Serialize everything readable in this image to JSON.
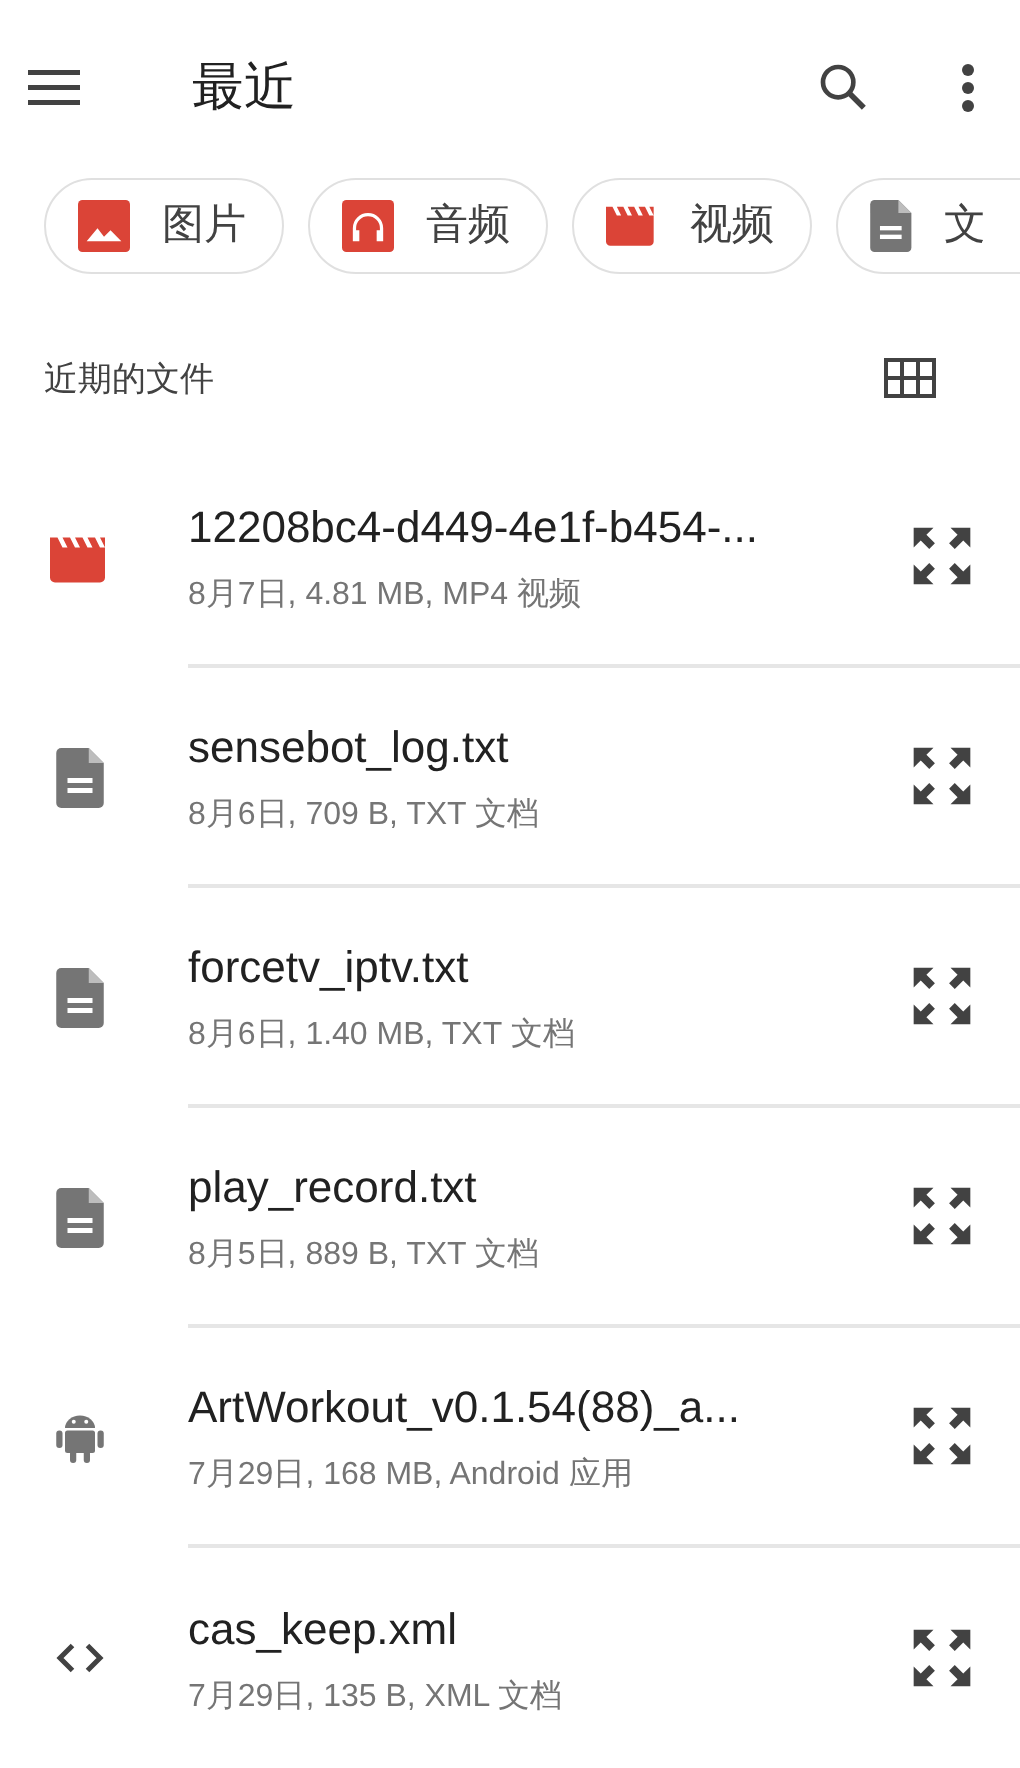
{
  "toolbar": {
    "title": "最近"
  },
  "categories": [
    {
      "kind": "image",
      "label": "图片"
    },
    {
      "kind": "audio",
      "label": "音频"
    },
    {
      "kind": "video",
      "label": "视频"
    },
    {
      "kind": "document",
      "label": "文"
    }
  ],
  "section": {
    "title": "近期的文件"
  },
  "files": [
    {
      "kind": "video",
      "name": "12208bc4-d449-4e1f-b454-...",
      "details": "8月7日, 4.81 MB, MP4 视频"
    },
    {
      "kind": "document",
      "name": "sensebot_log.txt",
      "details": "8月6日, 709 B, TXT 文档"
    },
    {
      "kind": "document",
      "name": "forcetv_iptv.txt",
      "details": "8月6日, 1.40 MB, TXT 文档"
    },
    {
      "kind": "document",
      "name": "play_record.txt",
      "details": "8月5日, 889 B, TXT 文档"
    },
    {
      "kind": "android",
      "name": "ArtWorkout_v0.1.54(88)_a...",
      "details": "7月29日, 168 MB, Android 应用"
    },
    {
      "kind": "code",
      "name": "cas_keep.xml",
      "details": "7月29日, 135 B, XML 文档"
    }
  ]
}
